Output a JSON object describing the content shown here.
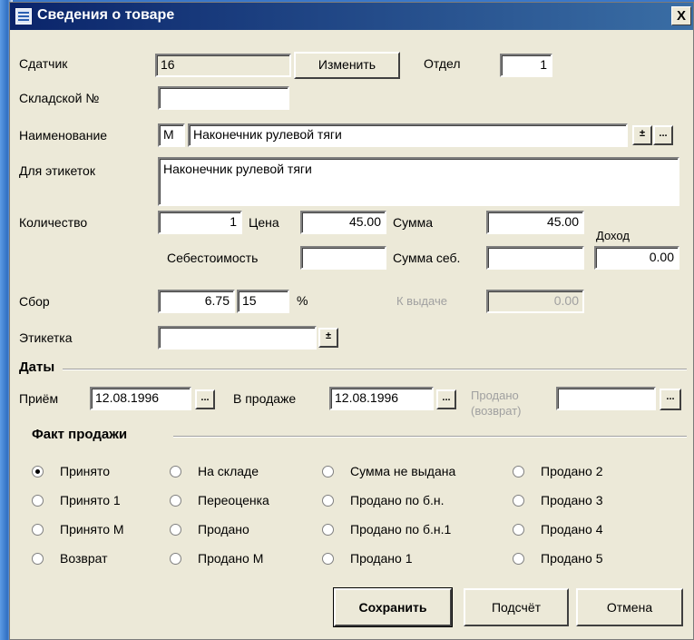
{
  "window": {
    "title": "Сведения о товаре",
    "close_label": "X"
  },
  "fields": {
    "consignor_label": "Сдатчик",
    "consignor_value": "16",
    "change_button": "Изменить",
    "department_label": "Отдел",
    "department_value": "1",
    "warehouse_label": "Складской №",
    "warehouse_value": "",
    "name_label": "Наименование",
    "name_prefix": "М",
    "name_value": "Наконечник рулевой тяги",
    "label_text_label": "Для этикеток",
    "label_text_value": "Наконечник рулевой тяги",
    "quantity_label": "Количество",
    "quantity_value": "1",
    "price_label": "Цена",
    "price_value": "45.00",
    "sum_label": "Сумма",
    "sum_value": "45.00",
    "income_label": "Доход",
    "income_value": "0.00",
    "cost_label": "Себестоимость",
    "cost_value": "",
    "cost_sum_label": "Сумма себ.",
    "cost_sum_value": "",
    "fee_label": "Сбор",
    "fee_value": "6.75",
    "fee_percent_value": "15",
    "percent_sign": "%",
    "payout_label": "К выдаче",
    "payout_value": "0.00",
    "tag_label": "Этикетка",
    "tag_value": ""
  },
  "dates": {
    "group_title": "Даты",
    "received_label": "Приём",
    "received_value": "12.08.1996",
    "on_sale_label": "В продаже",
    "on_sale_value": "12.08.1996",
    "sold_label_line1": "Продано",
    "sold_label_line2": "(возврат)",
    "sold_value": "",
    "picker_glyph": "..."
  },
  "sale_fact": {
    "group_title": "Факт продажи",
    "options": [
      [
        "Принято",
        "На складе",
        "Сумма не выдана",
        "Продано 2"
      ],
      [
        "Принято 1",
        "Переоценка",
        "Продано по б.н.",
        "Продано 3"
      ],
      [
        "Принято М",
        "Продано",
        "Продано по б.н.1",
        "Продано 4"
      ],
      [
        "Возврат",
        "Продано М",
        "Продано 1",
        "Продано 5"
      ]
    ],
    "selected": "Принято"
  },
  "buttons": {
    "save": "Сохранить",
    "count": "Подсчёт",
    "cancel": "Отмена"
  },
  "icons": {
    "dropdown": "±",
    "ellipsis": "..."
  }
}
